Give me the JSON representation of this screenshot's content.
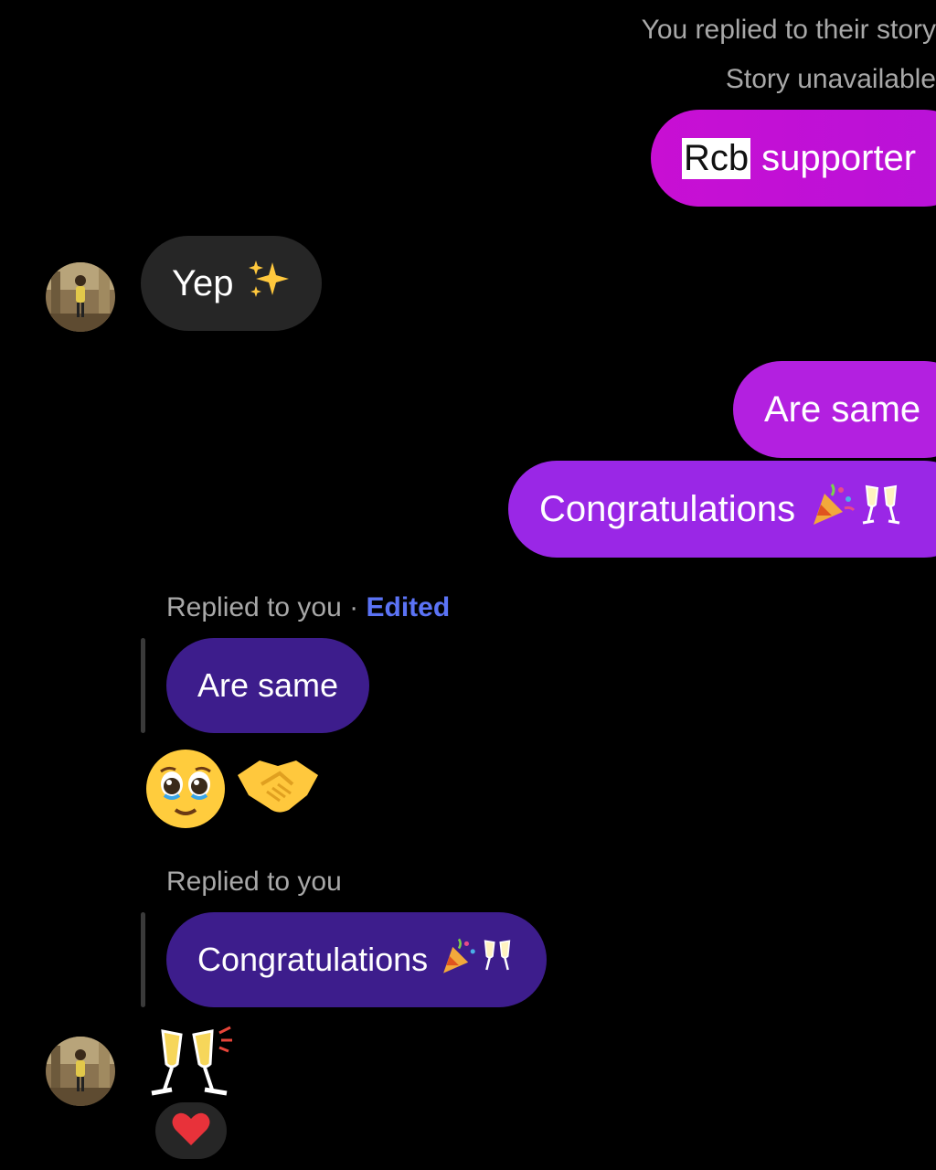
{
  "thread": {
    "story_reply_label": "You replied to their story",
    "story_status": "Story unavailable",
    "messages": [
      {
        "sender": "me",
        "highlight": "Rcb",
        "text": "supporter"
      },
      {
        "sender": "them",
        "text": "Yep",
        "emoji": "sparkles"
      },
      {
        "sender": "me",
        "text": "Are same"
      },
      {
        "sender": "me",
        "text": "Congratulations",
        "emoji": "party-popper, clinking-glasses"
      },
      {
        "sender": "them",
        "reply_label": "Replied to you",
        "reply_separator": "·",
        "edited_label": "Edited",
        "quoted_text": "Are same",
        "emoji": "pleading-face, handshake"
      },
      {
        "sender": "them",
        "reply_label": "Replied to you",
        "quoted_text": "Congratulations",
        "emoji": "clinking-glasses",
        "reaction": "red-heart"
      }
    ]
  },
  "colors": {
    "background": "#000000",
    "received_bubble": "#262626",
    "reply_bubble": "#3d1d8c",
    "sent_gradient_top": "#c511d6",
    "sent_gradient_bottom": "#9b2ee8",
    "meta_text": "#a8a8a8",
    "edited_link": "#5b73f5"
  }
}
